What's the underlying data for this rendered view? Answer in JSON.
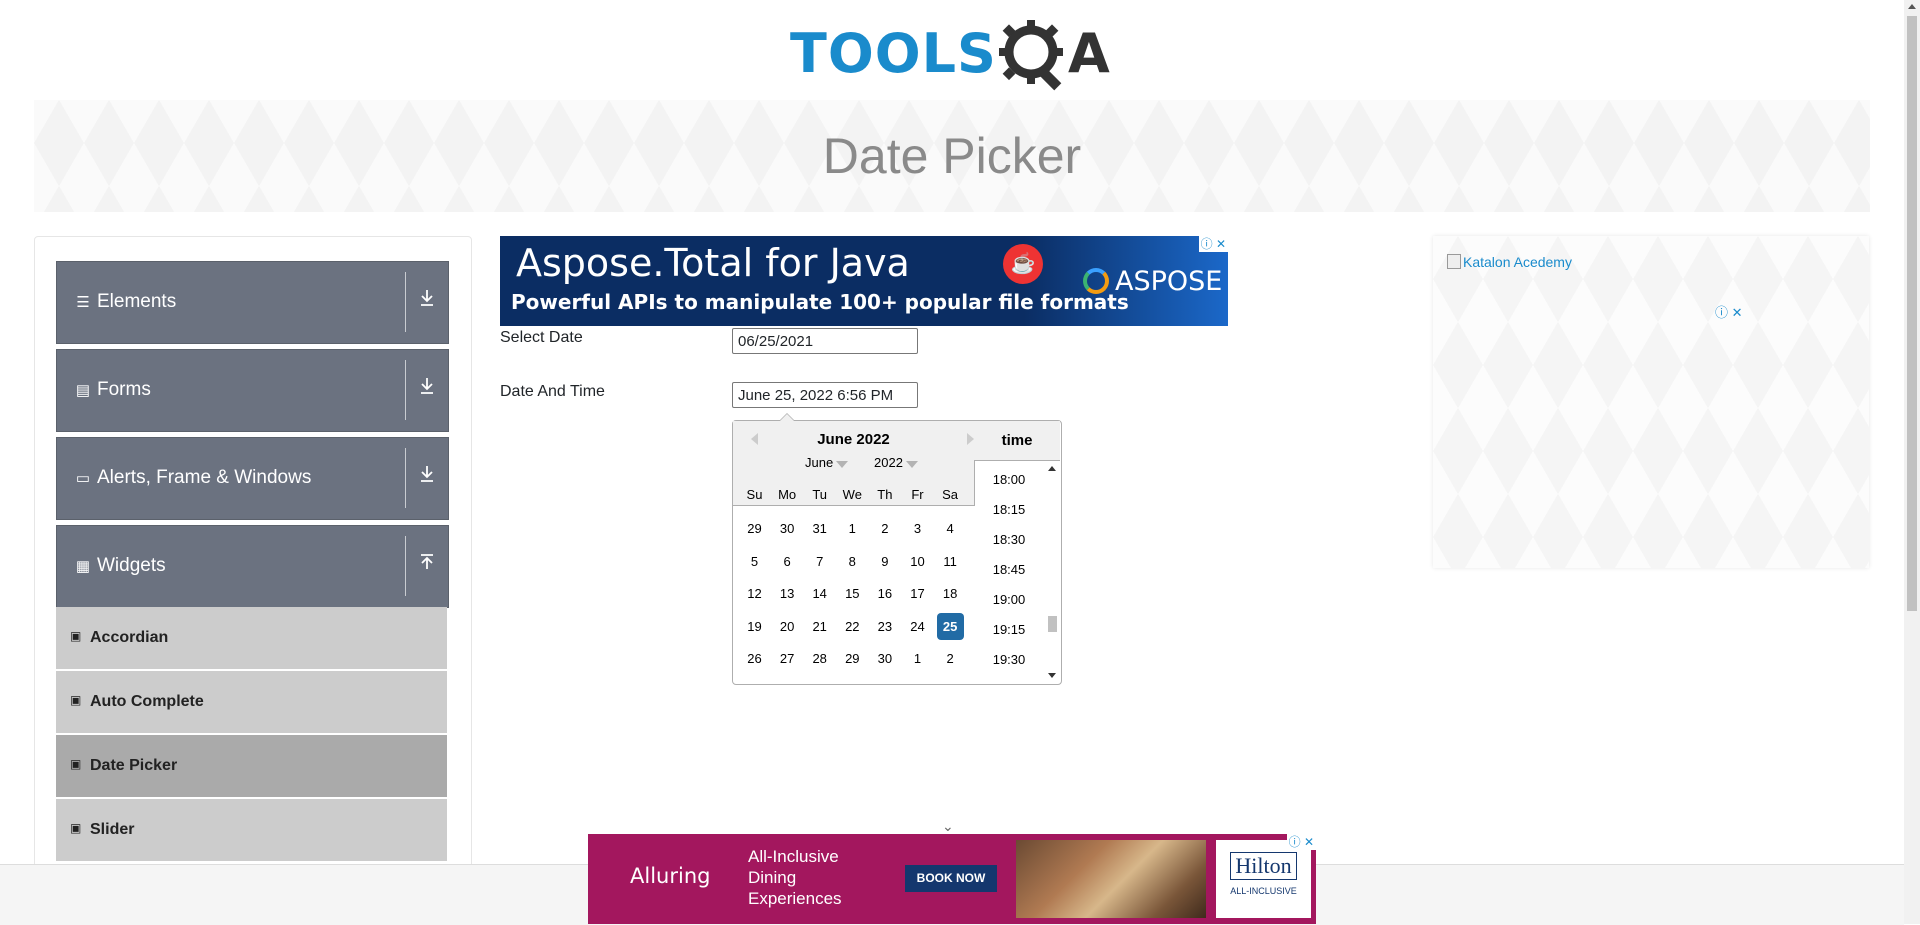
{
  "header": {
    "logo_text_tools": "TOOLS",
    "logo_text_a": "A"
  },
  "page_title": "Date Picker",
  "sidebar": {
    "groups": [
      {
        "label": "Elements",
        "icon": "hamburger-icon"
      },
      {
        "label": "Forms",
        "icon": "form-icon"
      },
      {
        "label": "Alerts, Frame & Windows",
        "icon": "window-icon"
      },
      {
        "label": "Widgets",
        "icon": "widgets-icon"
      }
    ],
    "widget_items": [
      {
        "label": "Accordian"
      },
      {
        "label": "Auto Complete"
      },
      {
        "label": "Date Picker",
        "active": true
      },
      {
        "label": "Slider"
      }
    ]
  },
  "ad_top": {
    "headline": "Aspose.Total for Java",
    "subline": "Powerful APIs to manipulate 100+ popular file formats",
    "brand": "ASPOSE"
  },
  "form": {
    "select_date_label": "Select Date",
    "select_date_value": "06/25/2021",
    "date_time_label": "Date And Time",
    "date_time_value": "June 25, 2022 6:56 PM"
  },
  "calendar": {
    "month_title": "June 2022",
    "month_dropdown": "June",
    "year_dropdown": "2022",
    "weekdays": [
      "Su",
      "Mo",
      "Tu",
      "We",
      "Th",
      "Fr",
      "Sa"
    ],
    "weeks": [
      [
        "29",
        "30",
        "31",
        "1",
        "2",
        "3",
        "4"
      ],
      [
        "5",
        "6",
        "7",
        "8",
        "9",
        "10",
        "11"
      ],
      [
        "12",
        "13",
        "14",
        "15",
        "16",
        "17",
        "18"
      ],
      [
        "19",
        "20",
        "21",
        "22",
        "23",
        "24",
        "25"
      ],
      [
        "26",
        "27",
        "28",
        "29",
        "30",
        "1",
        "2"
      ]
    ],
    "selected_day": "25",
    "time_header": "time",
    "times": [
      "18:00",
      "18:15",
      "18:30",
      "18:45",
      "19:00",
      "19:15",
      "19:30"
    ],
    "selected_color": "#216ba5"
  },
  "ad_right": {
    "alt_text": "Katalon Acedemy"
  },
  "ad_bottom": {
    "brand_line": "Alluring",
    "tagline": "All-Inclusive Dining Experiences",
    "cta": "BOOK NOW",
    "hotel": "Hilton",
    "hotel_sub": "ALL-INCLUSIVE"
  }
}
